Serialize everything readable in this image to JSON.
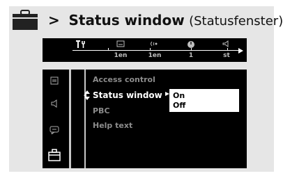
{
  "title": {
    "arrow": ">",
    "main": "Status window",
    "sub": "(Statusfenster)"
  },
  "menubar": {
    "items": [
      {
        "icon": "tools-icon",
        "glyph": "T⋅",
        "value": "",
        "active": true
      },
      {
        "icon": "subtitle-icon",
        "glyph": "▭",
        "value": "1en",
        "active": false
      },
      {
        "icon": "audio-icon",
        "glyph": "((·",
        "value": "1en",
        "active": false
      },
      {
        "icon": "angle-icon",
        "glyph": "●",
        "value": "1",
        "active": false
      },
      {
        "icon": "sound-icon",
        "glyph": "⊲",
        "value": "st",
        "active": false
      }
    ]
  },
  "sidebar": {
    "icons": [
      "subtitle-icon",
      "speaker-icon",
      "chat-icon",
      "toolbox-icon"
    ]
  },
  "menu": {
    "items": [
      {
        "label": "Access control",
        "active": false
      },
      {
        "label": "Status window",
        "active": true
      },
      {
        "label": "PBC",
        "active": false
      },
      {
        "label": "Help text",
        "active": false
      }
    ]
  },
  "submenu": {
    "options": [
      "On",
      "Off"
    ],
    "selected": "On"
  },
  "colors": {
    "panel_bg": "#e6e6e6",
    "screen_bg": "#000000",
    "active_text": "#ffffff",
    "inactive_text": "#8c8c8c"
  }
}
